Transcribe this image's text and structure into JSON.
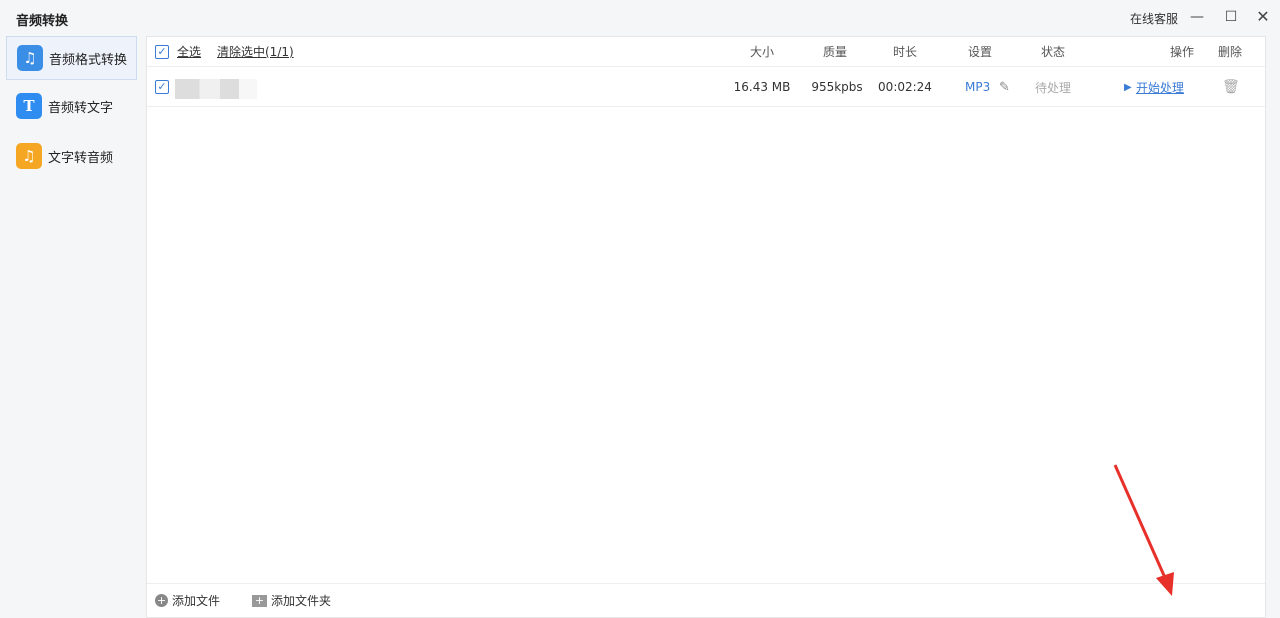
{
  "window": {
    "title": "音频转换",
    "service": "在线客服"
  },
  "sidebar": {
    "items": [
      {
        "label": "音频格式转换",
        "icon": "music-convert-icon",
        "color": "#3a8ee6"
      },
      {
        "label": "音频转文字",
        "icon": "audio-to-text-icon",
        "color": "#2f8cf0"
      },
      {
        "label": "文字转音频",
        "icon": "text-to-audio-icon",
        "color": "#f5a623"
      }
    ]
  },
  "table": {
    "select_all": "全选",
    "clear_selection": "清除选中(1/1)",
    "columns": [
      "大小",
      "质量",
      "时长",
      "设置",
      "状态",
      "操作",
      "删除"
    ],
    "rows": [
      {
        "size": "16.43 MB",
        "quality": "955kpbs",
        "duration": "00:02:24",
        "format": "MP3",
        "status": "待处理",
        "action": "开始处理"
      }
    ]
  },
  "footer": {
    "add_file": "添加文件",
    "add_folder": "添加文件夹"
  },
  "colors": {
    "accent": "#3a7bd5",
    "arrow": "#e8302a"
  }
}
